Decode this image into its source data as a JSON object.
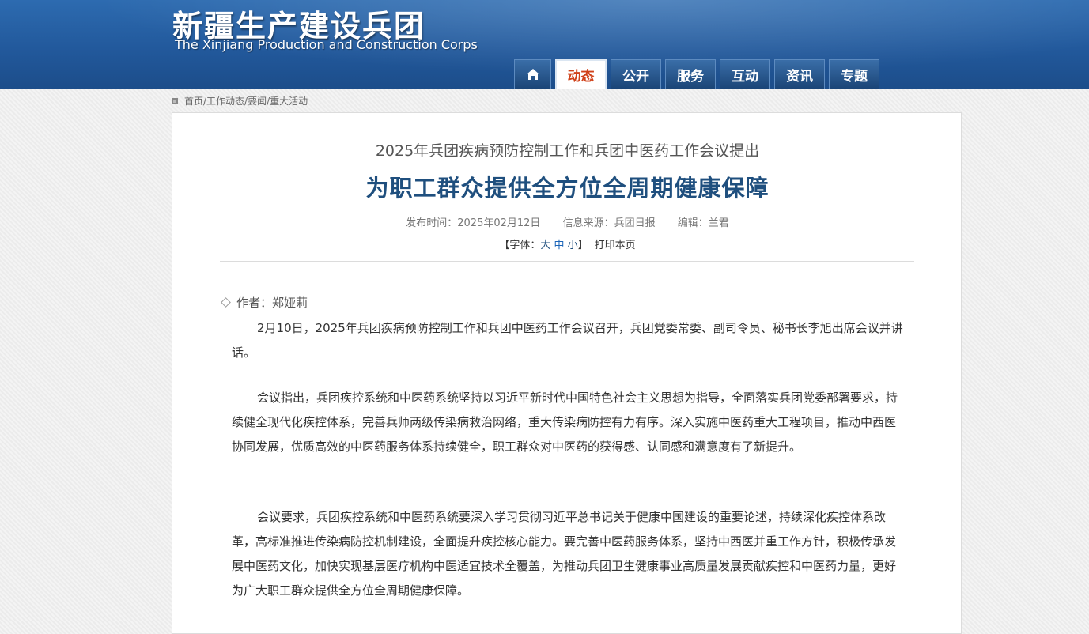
{
  "site": {
    "title_cn": "新疆生产建设兵团",
    "title_en": "The Xinjiang Production and Construction Corps"
  },
  "nav": {
    "home_icon": "home-icon",
    "tabs": [
      {
        "label": "动态",
        "active": true
      },
      {
        "label": "公开",
        "active": false
      },
      {
        "label": "服务",
        "active": false
      },
      {
        "label": "互动",
        "active": false
      },
      {
        "label": "资讯",
        "active": false
      },
      {
        "label": "专题",
        "active": false
      }
    ]
  },
  "breadcrumb": "首页/工作动态/要闻/重大活动",
  "article": {
    "subtitle": "2025年兵团疾病预防控制工作和兵团中医药工作会议提出",
    "title": "为职工群众提供全方位全周期健康保障",
    "date": "发布时间：2025年02月12日",
    "source": "信息来源：兵团日报",
    "editor": "编辑：兰君",
    "font_prefix": "【字体：",
    "font_large": "大",
    "font_medium": "中",
    "font_small": "小",
    "font_suffix": "】",
    "print": "打印本页",
    "author": "作者：郑娅莉",
    "paragraphs": [
      "2月10日，2025年兵团疾病预防控制工作和兵团中医药工作会议召开，兵团党委常委、副司令员、秘书长李旭出席会议并讲话。",
      "会议指出，兵团疾控系统和中医药系统坚持以习近平新时代中国特色社会主义思想为指导，全面落实兵团党委部署要求，持续健全现代化疾控体系，完善兵师两级传染病救治网络，重大传染病防控有力有序。深入实施中医药重大工程项目，推动中西医协同发展，优质高效的中医药服务体系持续健全，职工群众对中医药的获得感、认同感和满意度有了新提升。",
      "会议要求，兵团疾控系统和中医药系统要深入学习贯彻习近平总书记关于健康中国建设的重要论述，持续深化疾控体系改革，高标准推进传染病防控机制建设，全面提升疾控核心能力。要完善中医药服务体系，坚持中西医并重工作方针，积极传承发展中医药文化，加快实现基层医疗机构中医适宜技术全覆盖，为推动兵团卫生健康事业高质量发展贡献疾控和中医药力量，更好为广大职工群众提供全方位全周期健康保障。"
    ]
  },
  "colors": {
    "header_blue": "#22599c",
    "title_blue": "#1f4f7e",
    "active_tab_text": "#d0421b"
  }
}
